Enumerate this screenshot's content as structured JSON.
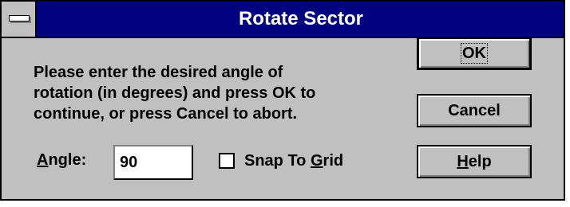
{
  "window": {
    "title": "Rotate Sector"
  },
  "message": {
    "line1": "Please enter the desired angle of",
    "line2": "rotation (in degrees) and press OK to",
    "line3": "continue, or press Cancel to abort."
  },
  "angle": {
    "label_mnemonic": "A",
    "label_rest": "ngle:",
    "value": "90"
  },
  "snap": {
    "label_prefix": "Snap To ",
    "label_mnemonic": "G",
    "label_rest": "rid",
    "checked": false
  },
  "buttons": {
    "ok": "OK",
    "cancel": "Cancel",
    "help_mnemonic": "H",
    "help_rest": "elp"
  },
  "icons": {
    "system_menu": "system-menu-icon"
  },
  "colors": {
    "titlebar": "#000080",
    "dialog_face": "#c0c0c0"
  }
}
